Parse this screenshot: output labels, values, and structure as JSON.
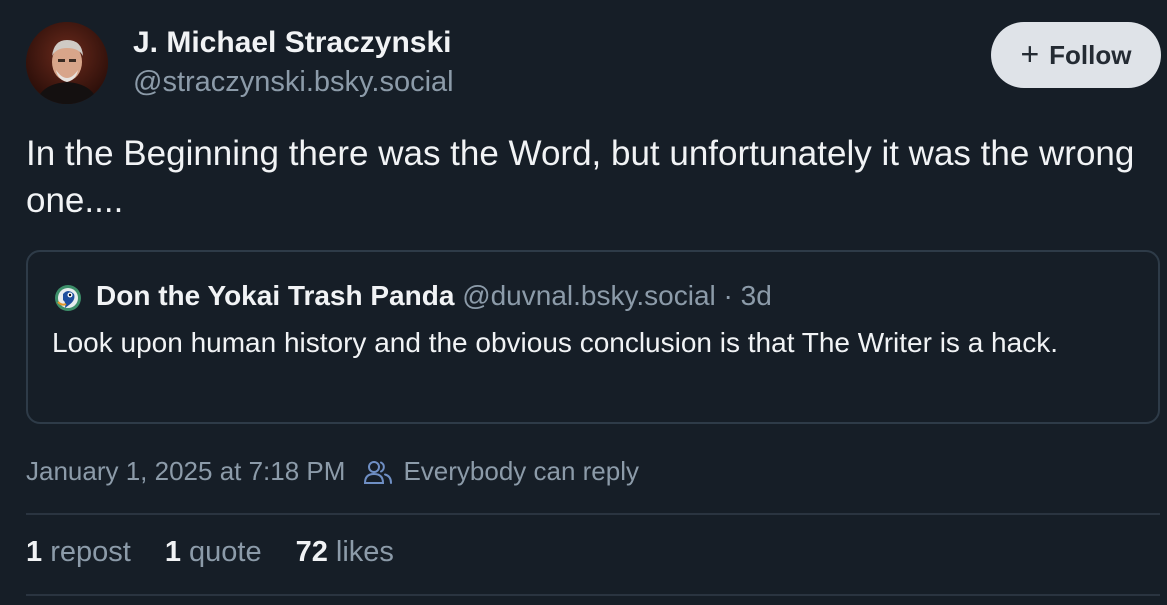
{
  "author": {
    "name": "J. Michael Straczynski",
    "handle": "@straczynski.bsky.social"
  },
  "follow_button": {
    "icon": "plus-icon",
    "label": "Follow"
  },
  "post": {
    "text": "In the Beginning there was the Word, but unfortunately it was the wrong one...."
  },
  "quoted_post": {
    "author_name": "Don the Yokai Trash Panda",
    "author_handle": "@duvnal.bsky.social",
    "separator": "·",
    "age": "3d",
    "text": "Look upon human history and the obvious conclusion is that The Writer is a hack."
  },
  "meta": {
    "timestamp": "January 1, 2025 at 7:18 PM",
    "reply_icon": "people-icon",
    "reply_setting": "Everybody can reply"
  },
  "stats": {
    "reposts_count": "1",
    "reposts_label": "repost",
    "quotes_count": "1",
    "quotes_label": "quote",
    "likes_count": "72",
    "likes_label": "likes"
  },
  "colors": {
    "background": "#161e27",
    "text_primary": "#f1f3f5",
    "text_secondary": "#8c9ba9",
    "border": "#2e3b48",
    "follow_bg": "#dfe3e8"
  }
}
